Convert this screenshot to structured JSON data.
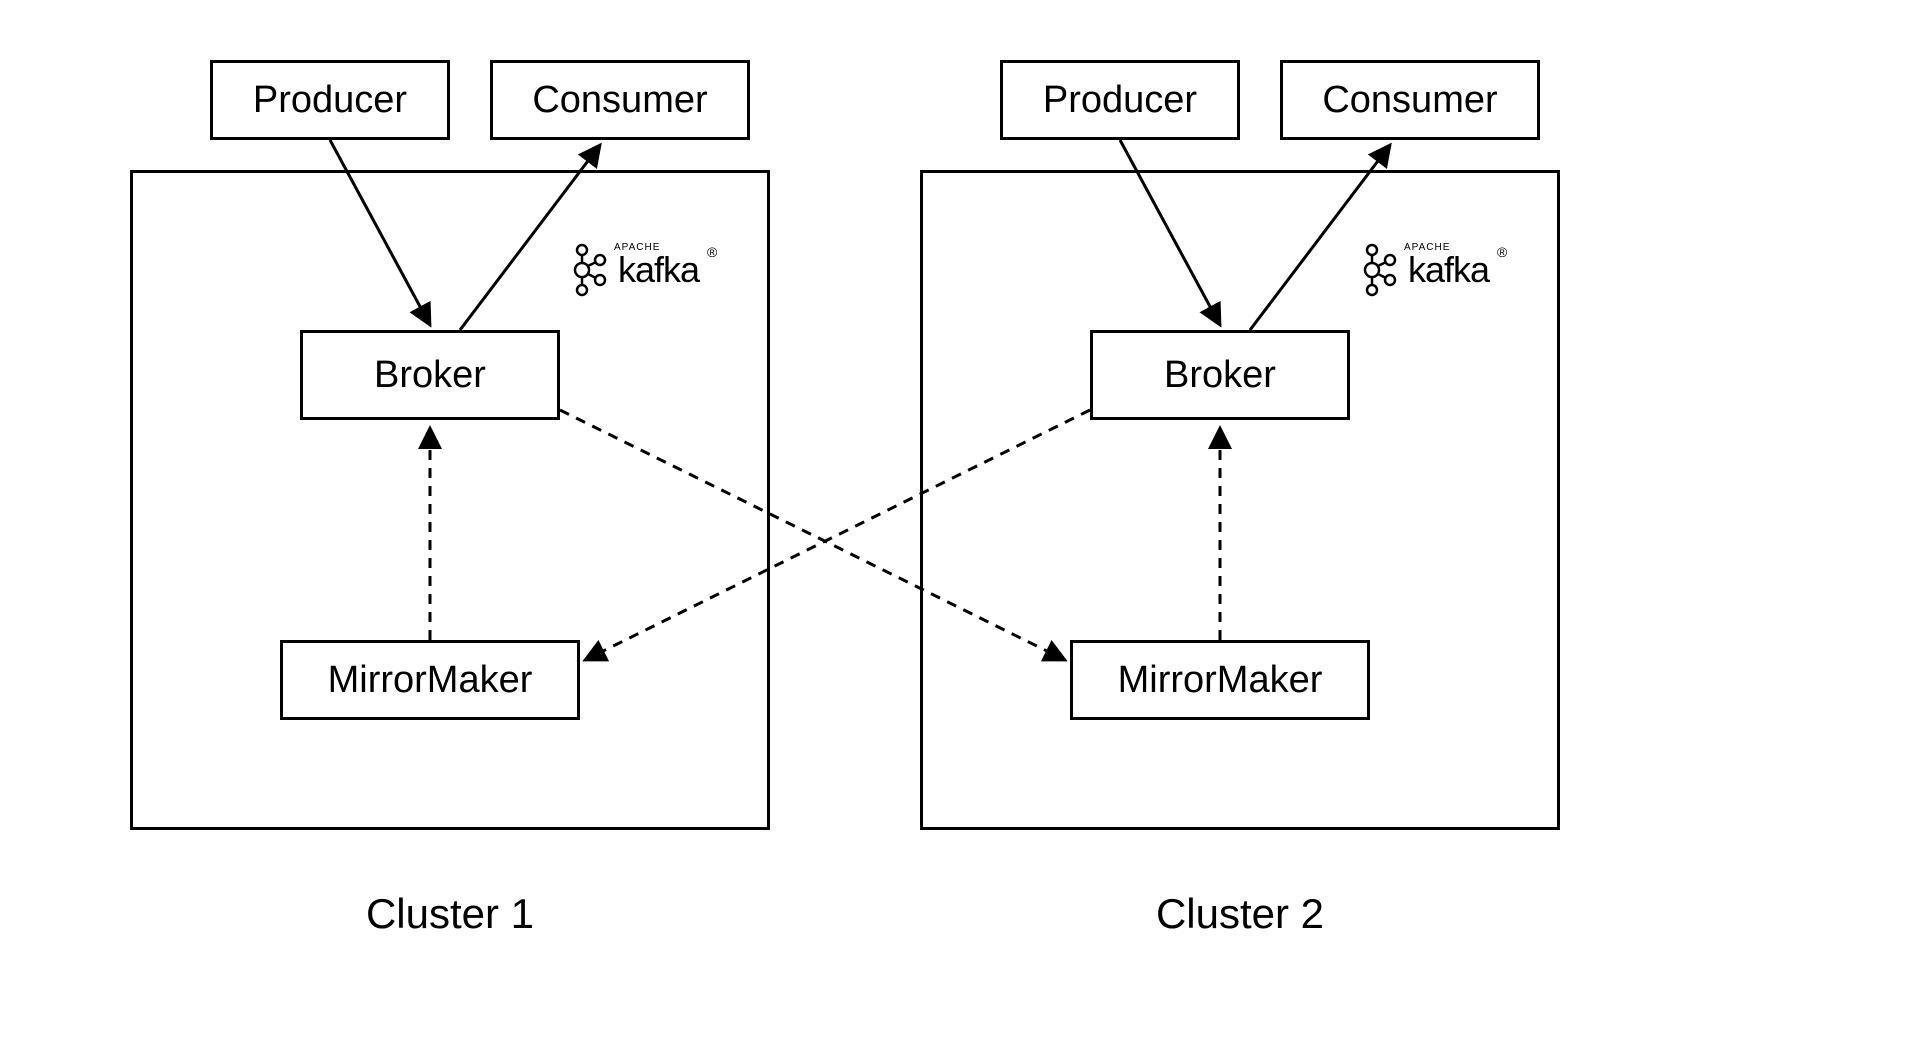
{
  "clusters": [
    {
      "label": "Cluster 1",
      "producer": "Producer",
      "consumer": "Consumer",
      "broker": "Broker",
      "mirrormaker": "MirrorMaker",
      "kafka_brand": "kafka",
      "kafka_brand_small": "APACHE"
    },
    {
      "label": "Cluster 2",
      "producer": "Producer",
      "consumer": "Consumer",
      "broker": "Broker",
      "mirrormaker": "MirrorMaker",
      "kafka_brand": "kafka",
      "kafka_brand_small": "APACHE"
    }
  ]
}
